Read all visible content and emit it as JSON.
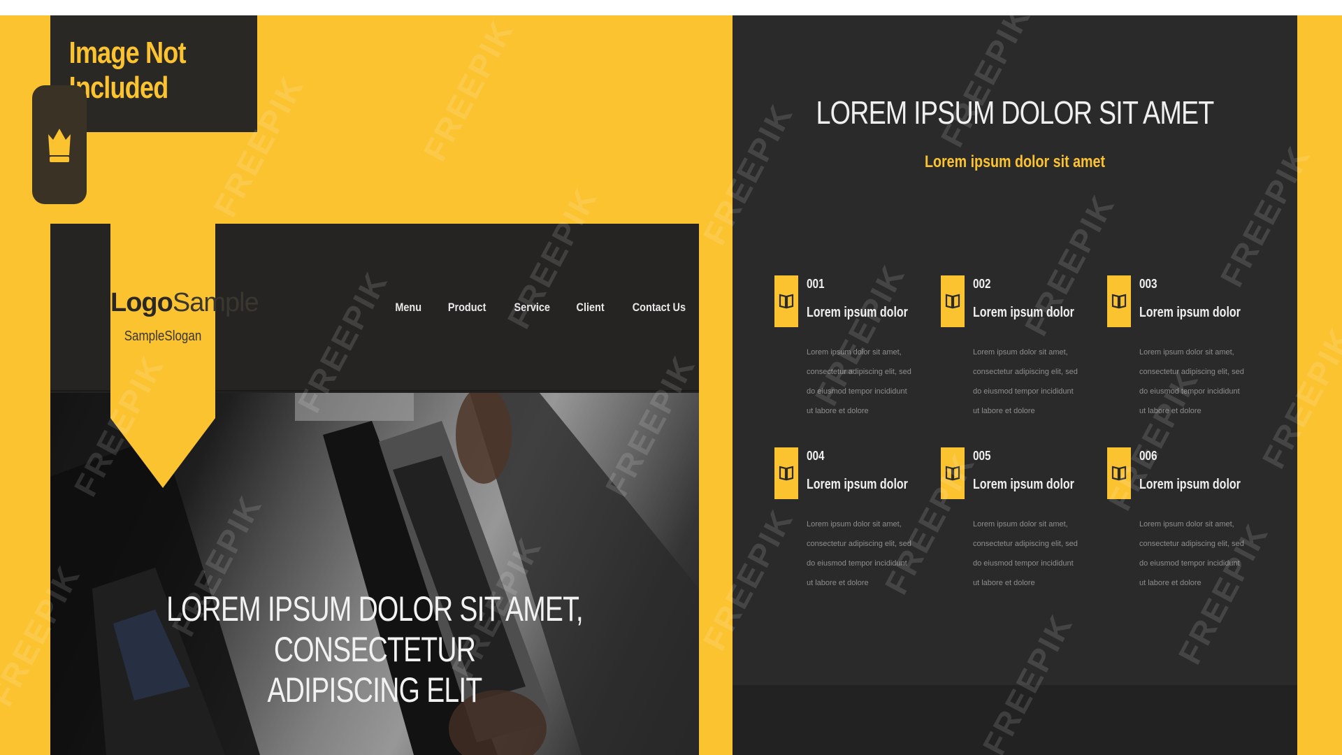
{
  "badge": {
    "text": "Image Not Included"
  },
  "mockup": {
    "logo": {
      "strong": "Logo",
      "light": "Sample",
      "slogan": "SampleSlogan"
    },
    "nav": [
      "Menu",
      "Product",
      "Service",
      "Client",
      "Contact Us"
    ],
    "hero": {
      "line1": "LOREM IPSUM DOLOR SIT AMET, CONSECTETUR",
      "line2": "ADIPISCING ELIT"
    }
  },
  "panel": {
    "title": "LOREM IPSUM DOLOR SIT AMET",
    "subtitle": "Lorem ipsum dolor sit amet",
    "features": [
      {
        "number": "001",
        "title": "Lorem ipsum dolor",
        "body": "Lorem ipsum dolor sit amet, consectetur adipiscing elit, sed do eiusmod tempor incididunt ut labore et dolore",
        "icon": "book-icon"
      },
      {
        "number": "002",
        "title": "Lorem ipsum dolor",
        "body": "Lorem ipsum dolor sit amet, consectetur adipiscing elit, sed do eiusmod tempor incididunt ut labore et dolore",
        "icon": "book-icon"
      },
      {
        "number": "003",
        "title": "Lorem ipsum dolor",
        "body": "Lorem ipsum dolor sit amet, consectetur adipiscing elit, sed do eiusmod tempor incididunt ut labore et dolore",
        "icon": "book-icon"
      },
      {
        "number": "004",
        "title": "Lorem ipsum dolor",
        "body": "Lorem ipsum dolor sit amet, consectetur adipiscing elit, sed do eiusmod tempor incididunt ut labore et dolore",
        "icon": "book-icon"
      },
      {
        "number": "005",
        "title": "Lorem ipsum dolor",
        "body": "Lorem ipsum dolor sit amet, consectetur adipiscing elit, sed do eiusmod tempor incididunt ut labore et dolore",
        "icon": "book-icon"
      },
      {
        "number": "006",
        "title": "Lorem ipsum dolor",
        "body": "Lorem ipsum dolor sit amet, consectetur adipiscing elit, sed do eiusmod tempor incididunt ut labore et dolore",
        "icon": "book-icon"
      }
    ]
  },
  "watermark": "FREEPIK",
  "colors": {
    "accent": "#fcc330",
    "dark": "#2a2a2a",
    "text_light": "#f0f0f0"
  }
}
